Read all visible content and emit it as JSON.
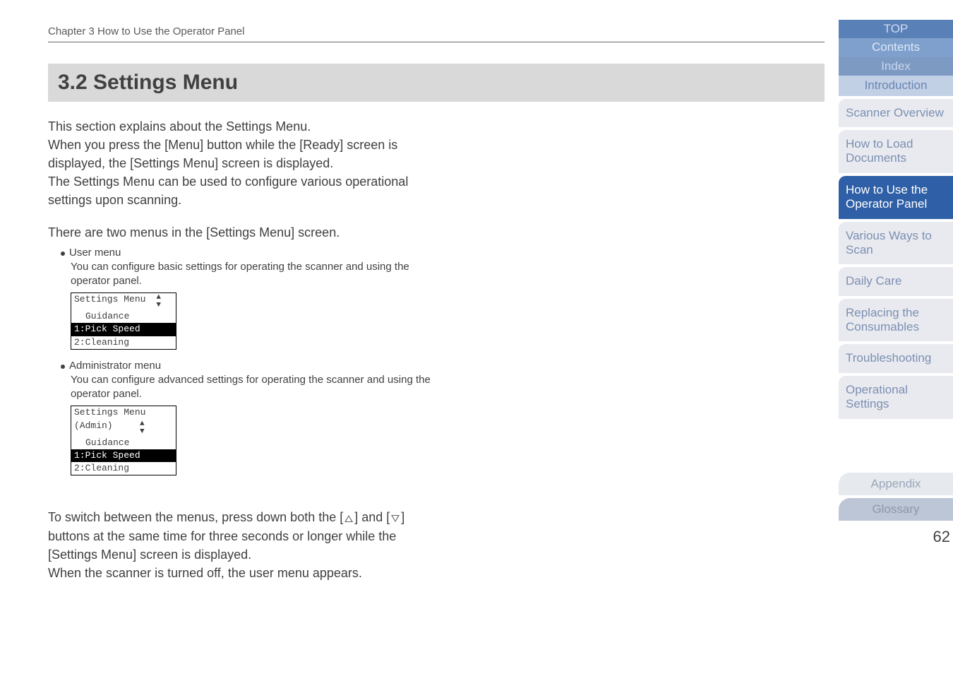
{
  "chapter_line": "Chapter 3 How to Use the Operator Panel",
  "section_title": "3.2 Settings Menu",
  "para1": "This section explains about the Settings Menu.\nWhen you press the [Menu] button while the [Ready] screen is displayed, the [Settings Menu] screen is displayed.\nThe Settings Menu can be used to configure various operational settings upon scanning.",
  "para2_intro": "There are two menus in the [Settings Menu] screen.",
  "bullet_user_title": "User menu",
  "bullet_user_desc": "You can configure basic settings for operating the scanner and using the operator panel.",
  "bullet_admin_title": "Administrator menu",
  "bullet_admin_desc": "You can configure advanced settings for operating the scanner and using the operator panel.",
  "lcd_user": {
    "header": "Settings Menu",
    "rows": [
      "Guidance",
      "1:Pick Speed",
      "2:Cleaning"
    ],
    "selected_index": 1
  },
  "lcd_admin": {
    "header": "Settings Menu",
    "sub": "(Admin)",
    "rows": [
      "Guidance",
      "1:Pick Speed",
      "2:Cleaning"
    ],
    "selected_index": 1
  },
  "para3_a": "To switch between the menus, press down both the [",
  "para3_b": "] and [",
  "para3_c": "] buttons at the same time for three seconds or longer while the [Settings Menu] screen is displayed.\nWhen the scanner is turned off, the user menu appears.",
  "sidebar": {
    "top": "TOP",
    "contents": "Contents",
    "index": "Index",
    "introduction": "Introduction",
    "scanner": "Scanner Overview",
    "load": "How to Load Documents",
    "use": "How to Use the Operator Panel",
    "ways": "Various Ways to Scan",
    "daily": "Daily Care",
    "replace": "Replacing the Consumables",
    "trouble": "Troubleshooting",
    "ops": "Operational Settings",
    "appendix": "Appendix",
    "glossary": "Glossary"
  },
  "page_number": "62"
}
